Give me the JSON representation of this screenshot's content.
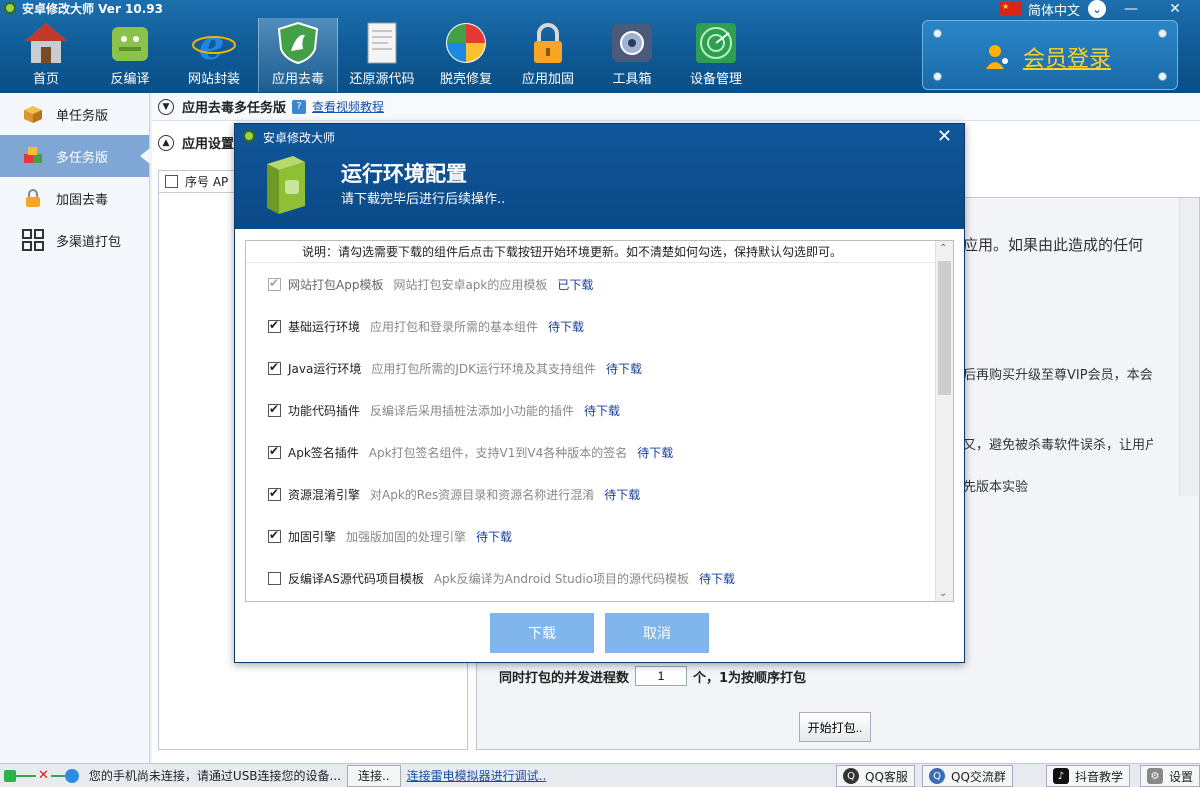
{
  "app": {
    "title": "安卓修改大师 Ver 10.93"
  },
  "nav": [
    {
      "label": "首页",
      "icon": "house-icon",
      "color": "#c0392b"
    },
    {
      "label": "反编译",
      "icon": "android-icon",
      "color": "#8bc34a"
    },
    {
      "label": "网站封装",
      "icon": "ie-icon",
      "color": "#1e88e5"
    },
    {
      "label": "应用去毒",
      "icon": "shield-icon",
      "color": "#43a047"
    },
    {
      "label": "还原源代码",
      "icon": "document-icon",
      "color": "#eeeeee"
    },
    {
      "label": "脱壳修复",
      "icon": "windows-ball-icon",
      "color": "#fbc02d"
    },
    {
      "label": "应用加固",
      "icon": "lock-icon",
      "color": "#f5a623"
    },
    {
      "label": "工具箱",
      "icon": "toolbox-icon",
      "color": "#5c6bc0"
    },
    {
      "label": "设备管理",
      "icon": "radar-icon",
      "color": "#2e9e4f"
    }
  ],
  "header": {
    "language": "简体中文",
    "member_login": "会员登录"
  },
  "sidebar": {
    "items": [
      {
        "label": "单任务版",
        "icon": "box-icon"
      },
      {
        "label": "多任务版",
        "icon": "boxes-icon"
      },
      {
        "label": "加固去毒",
        "icon": "lock-icon"
      },
      {
        "label": "多渠道打包",
        "icon": "grid-icon"
      }
    ]
  },
  "main": {
    "title": "应用去毒多任务版",
    "tutorial_link": "查看视频教程",
    "settings_label": "应用设置",
    "table_header": "序号 AP",
    "right_panel_lines": [
      "应用。如果由此造成的任何",
      "后再购买升级至尊VIP会员，本会",
      "",
      "又，避免被杀毒软件误杀，让用户",
      "先版本实验"
    ],
    "concurrency_label": "同时打包的并发进程数",
    "concurrency_value": "1",
    "concurrency_suffix": "个，1为按顺序打包",
    "start_button": "开始打包.."
  },
  "modal": {
    "small_title": "安卓修改大师",
    "title": "运行环境配置",
    "subtitle": "请下载完毕后进行后续操作..",
    "note": "说明：请勾选需要下载的组件后点击下载按钮开始环境更新。如不清楚如何勾选，保持默认勾选即可。",
    "components": [
      {
        "name": "网站打包App模板",
        "desc": "网站打包安卓apk的应用模板",
        "status": "已下载",
        "checked": true,
        "disabled": true
      },
      {
        "name": "基础运行环境",
        "desc": "应用打包和登录所需的基本组件",
        "status": "待下载",
        "checked": true,
        "disabled": false
      },
      {
        "name": "Java运行环境",
        "desc": "应用打包所需的JDK运行环境及其支持组件",
        "status": "待下载",
        "checked": true,
        "disabled": false
      },
      {
        "name": "功能代码插件",
        "desc": "反编译后采用插桩法添加小功能的插件",
        "status": "待下载",
        "checked": true,
        "disabled": false
      },
      {
        "name": "Apk签名插件",
        "desc": "Apk打包签名组件，支持V1到V4各种版本的签名",
        "status": "待下载",
        "checked": true,
        "disabled": false
      },
      {
        "name": "资源混淆引擎",
        "desc": "对Apk的Res资源目录和资源名称进行混淆",
        "status": "待下载",
        "checked": true,
        "disabled": false
      },
      {
        "name": "加固引擎",
        "desc": "加强版加固的处理引擎",
        "status": "待下载",
        "checked": true,
        "disabled": false
      },
      {
        "name": "反编译AS源代码项目模板",
        "desc": "Apk反编译为Android Studio项目的源代码模板",
        "status": "待下载",
        "checked": false,
        "disabled": false
      }
    ],
    "download_button": "下载",
    "cancel_button": "取消"
  },
  "statusbar": {
    "text": "您的手机尚未连接，请通过USB连接您的设备...",
    "connect_button": "连接..",
    "leidian_link": "连接雷电模拟器进行调试..",
    "qq_service": "QQ客服",
    "qq_group": "QQ交流群",
    "douyin": "抖音教学",
    "settings": "设置"
  },
  "colors": {
    "header_blue": "#0f5a96",
    "link_blue": "#1a4fa6",
    "member_gold": "#ffd12a",
    "button_blue": "#80b6ec"
  }
}
